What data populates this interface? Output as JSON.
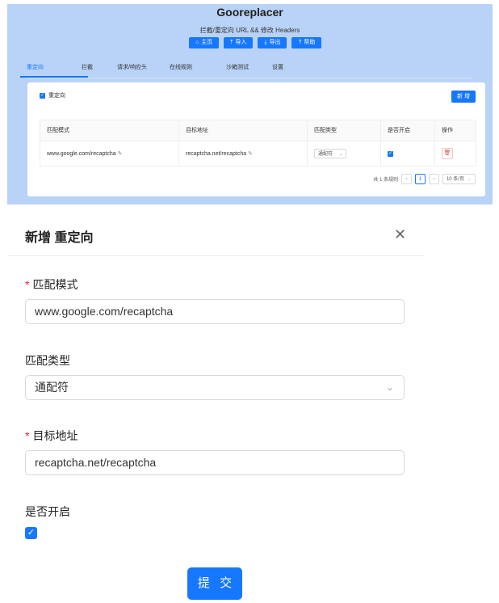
{
  "app": {
    "title": "Gooreplacer",
    "subtitle": "拦截/重定向 URL && 修改 Headers",
    "nav_buttons": [
      {
        "icon": "home-icon",
        "glyph": "⌂",
        "label": "主页"
      },
      {
        "icon": "upload-icon",
        "glyph": "⤒",
        "label": "导入"
      },
      {
        "icon": "download-icon",
        "glyph": "⤓",
        "label": "导出"
      },
      {
        "icon": "question-icon",
        "glyph": "?",
        "label": "帮助"
      }
    ],
    "tabs": [
      "重定向",
      "拦截",
      "请求/响应头",
      "在线规则",
      "沙箱测试",
      "设置"
    ],
    "active_tab": "重定向",
    "enable_label": "重定向",
    "add_button": "新 增",
    "table": {
      "headers": [
        "匹配模式",
        "目标地址",
        "匹配类型",
        "是否开启",
        "操作"
      ],
      "rows": [
        {
          "pattern": "www.google.com/recaptcha",
          "target": "recaptcha.net/recaptcha",
          "match_type": "通配符",
          "enabled": true
        }
      ]
    },
    "pagination": {
      "total_text": "共 1 条规则",
      "current_page": "1",
      "page_size": "10 条/页"
    }
  },
  "modal": {
    "title": "新增 重定向",
    "fields": {
      "pattern_label": "匹配模式",
      "pattern_value": "www.google.com/recaptcha",
      "match_type_label": "匹配类型",
      "match_type_value": "通配符",
      "target_label": "目标地址",
      "target_value": "recaptcha.net/recaptcha",
      "enabled_label": "是否开启"
    },
    "submit_label": "提 交"
  },
  "colors": {
    "primary": "#1677ff",
    "required": "#f5222d",
    "header_bg": "#b9d2f7"
  }
}
